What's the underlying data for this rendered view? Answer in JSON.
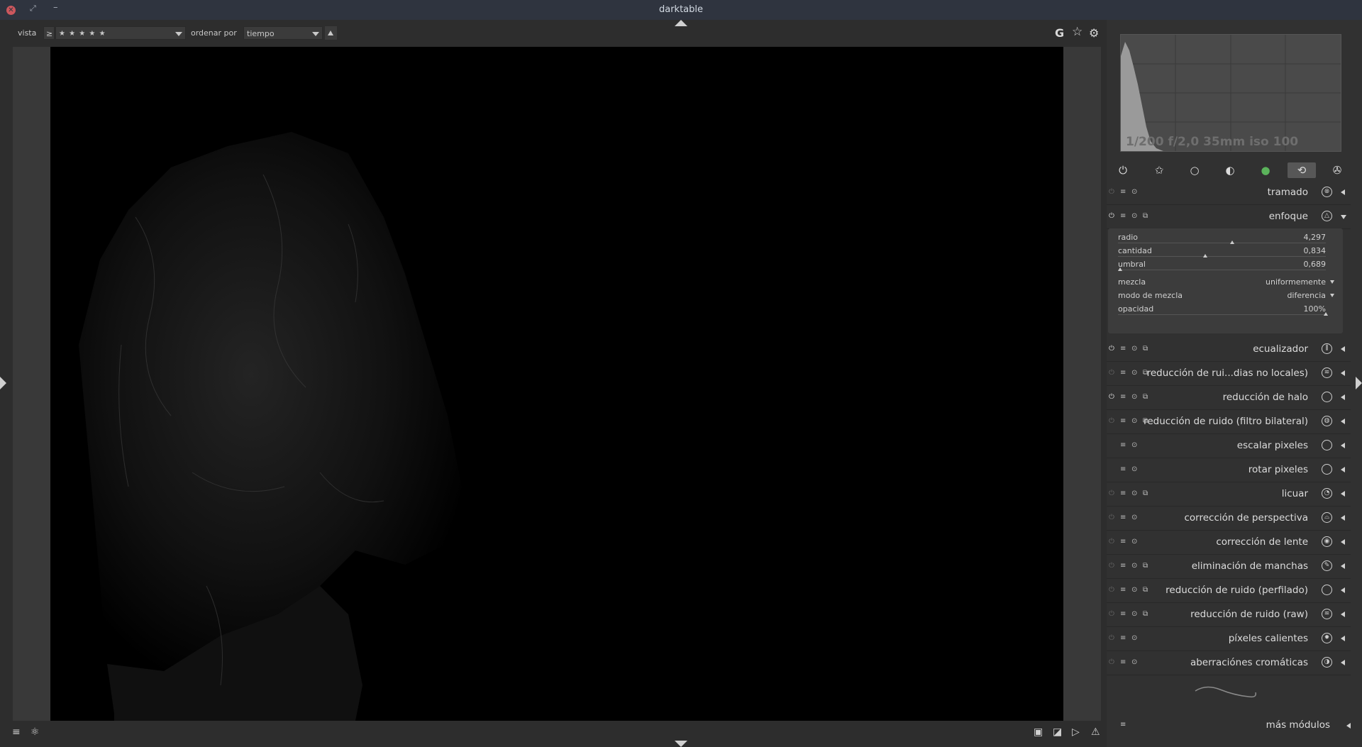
{
  "window": {
    "title": "darktable"
  },
  "filter": {
    "view_label": "vista",
    "rating_op": "≥",
    "rating_value": "★ ★ ★ ★ ★",
    "sort_label": "ordenar por",
    "sort_value": "tiempo"
  },
  "toolbar_right": {
    "grouping": "G",
    "overlay": "☆",
    "prefs": "⚙"
  },
  "bottom_left": {
    "menu": "≡",
    "styles": "⚛"
  },
  "bottom_right": {
    "softproof": "▣",
    "gamut": "◪",
    "tone": "▷",
    "warning": "⚠"
  },
  "histogram": {
    "exif": "1/200 f/2,0 35mm iso 100"
  },
  "module_groups": [
    {
      "name": "power",
      "glyph": "⏻"
    },
    {
      "name": "favorites",
      "glyph": "✩"
    },
    {
      "name": "basic",
      "glyph": "○"
    },
    {
      "name": "tone",
      "glyph": "◐"
    },
    {
      "name": "color",
      "glyph": "●"
    },
    {
      "name": "correct",
      "glyph": "⟲"
    },
    {
      "name": "effect",
      "glyph": "✇"
    }
  ],
  "modules": [
    {
      "name": "tramado",
      "icon": "⊗"
    },
    {
      "name": "enfoque",
      "icon": "△"
    },
    {
      "name": "ecualizador",
      "icon": "⫼"
    },
    {
      "name": "reducción de rui...dias no locales)",
      "icon": "≋"
    },
    {
      "name": "reducción de halo",
      "icon": ""
    },
    {
      "name": "reducción de ruido (filtro bilateral)",
      "icon": "◍"
    },
    {
      "name": "escalar pixeles",
      "icon": ""
    },
    {
      "name": "rotar pixeles",
      "icon": ""
    },
    {
      "name": "licuar",
      "icon": "◔"
    },
    {
      "name": "corrección de perspectiva",
      "icon": "⌓"
    },
    {
      "name": "corrección de lente",
      "icon": "◉"
    },
    {
      "name": "eliminación de manchas",
      "icon": "✎"
    },
    {
      "name": "reducción de ruido (perfilado)",
      "icon": ""
    },
    {
      "name": "reducción de ruido (raw)",
      "icon": "≋"
    },
    {
      "name": "píxeles calientes",
      "icon": "✹"
    },
    {
      "name": "aberraciónes cromáticas",
      "icon": "◑"
    }
  ],
  "enfoque": {
    "radio": {
      "label": "radio",
      "value": "4,297",
      "level": 0.55
    },
    "cantidad": {
      "label": "cantidad",
      "value": "0,834",
      "level": 0.42
    },
    "umbral": {
      "label": "umbral",
      "value": "0,689",
      "level": 0.01
    },
    "mezcla": {
      "label": "mezcla",
      "value": "uniformemente"
    },
    "modo": {
      "label": "modo de mezcla",
      "value": "diferencia"
    },
    "opacidad": {
      "label": "opacidad",
      "value": "100%",
      "level": 1.0
    }
  },
  "more_modules": "más módulos",
  "colors": {
    "panel": "#313131",
    "image_bg": "#000000",
    "titlebar": "#2f343f"
  }
}
